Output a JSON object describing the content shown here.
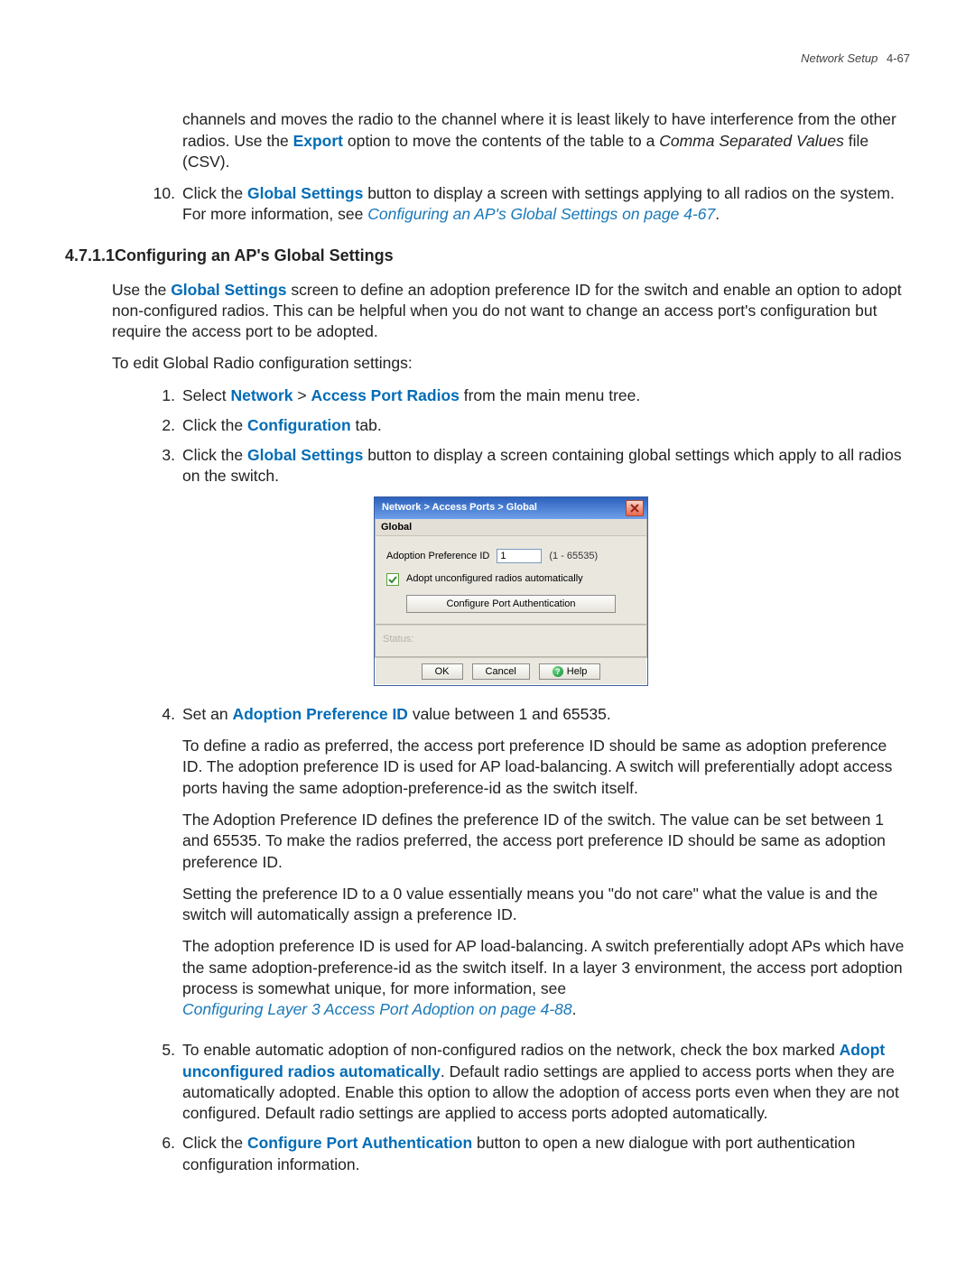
{
  "header": {
    "running": "Network Setup",
    "page_num": "4-67"
  },
  "intro_para": {
    "part1": "channels and moves the radio to the channel where it is least likely to have interference from the other radios. Use the ",
    "export": "Export",
    "part2": " option to move the contents of the table to a ",
    "csv_ital": "Comma Separated Values",
    "part3": " file (CSV)."
  },
  "step10": {
    "num": "10.",
    "a": "Click the ",
    "gs": "Global Settings",
    "b": " button to display a screen with settings applying to all radios on the system. For more information, see ",
    "link": "Configuring an AP's Global Settings on page 4-67",
    "c": "."
  },
  "section": {
    "num": "4.7.1.1",
    "title": "Configuring an AP's Global Settings"
  },
  "p_use": {
    "a": "Use the ",
    "gs": "Global Settings",
    "b": " screen to define an adoption preference ID for the switch and enable an option to adopt non-configured radios. This can be helpful when you do not want to change an access port's configuration but require the access port to be adopted."
  },
  "p_edit": "To edit Global Radio configuration settings:",
  "steps_a": {
    "s1": {
      "num": "1.",
      "a": "Select ",
      "network": "Network",
      "gt": " > ",
      "apr": "Access Port Radios",
      "b": " from the main menu tree."
    },
    "s2": {
      "num": "2.",
      "a": "Click the ",
      "conf": "Configuration",
      "b": " tab."
    },
    "s3": {
      "num": "3.",
      "a": "Click the ",
      "gs": "Global Settings",
      "b": " button to display a screen containing global settings which apply to all radios on the switch."
    }
  },
  "dialog": {
    "title": "Network > Access Ports > Global",
    "section_title": "Global",
    "adopt_label": "Adoption Preference ID",
    "adopt_value": "1",
    "adopt_range": "(1 - 65535)",
    "check_label": "Adopt unconfigured radios automatically",
    "cfg_button": "Configure Port Authentication",
    "status_label": "Status:",
    "ok": "OK",
    "cancel": "Cancel",
    "help": "Help"
  },
  "steps_b": {
    "s4": {
      "num": "4.",
      "line1a": "Set an ",
      "line1b": "Adoption Preference ID",
      "line1c": " value between 1 and 65535.",
      "p2": "To define a radio as preferred, the access port preference ID should be same as adoption preference ID. The adoption preference ID is used for AP load-balancing. A switch will preferentially adopt access ports having the same adoption-preference-id as the switch itself.",
      "p3": "The Adoption Preference ID defines the preference ID of the switch. The value can be set between 1 and 65535. To make the radios preferred, the access port preference ID should be same as adoption preference ID.",
      "p4": "Setting the preference ID to a 0 value essentially means you \"do not care\" what the value is and the switch will automatically assign a preference ID.",
      "p5a": "The adoption preference ID is used for AP load-balancing. A switch preferentially adopt APs which have the same adoption-preference-id as the switch itself. In a layer 3 environment, the access port adoption process is somewhat unique, for more information, see",
      "p5link": "Configuring Layer 3 Access Port Adoption on page 4-88",
      "p5c": "."
    },
    "s5": {
      "num": "5.",
      "a": "To enable automatic adoption of non-configured radios on the network, check the box marked ",
      "b": "Adopt unconfigured radios automatically",
      "c": ". Default radio settings are applied to access ports when they are automatically adopted. Enable this option to allow the adoption of access ports even when they are not configured. Default radio settings are applied to access ports adopted automatically."
    },
    "s6": {
      "num": "6.",
      "a": "Click the ",
      "b": "Configure Port Authentication",
      "c": " button to open a new dialogue with port authentication configuration information."
    }
  }
}
